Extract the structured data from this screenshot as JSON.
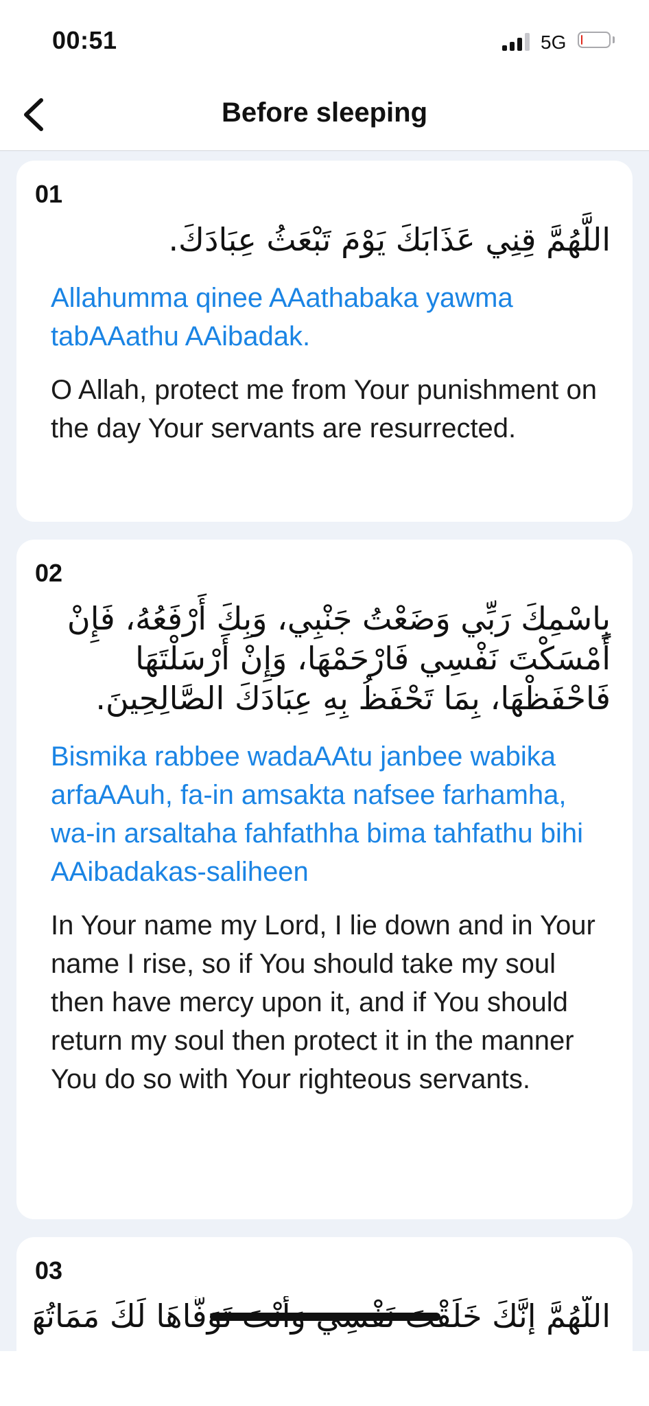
{
  "status_bar": {
    "time": "00:51",
    "network": "5G",
    "signal_bars_active": 3,
    "signal_bars_total": 4,
    "battery_level_percent": 5,
    "battery_color": "#e0281b"
  },
  "nav": {
    "back_icon": "chevron-left-icon",
    "title": "Before sleeping"
  },
  "colors": {
    "accent": "#1a84e4",
    "background": "#eef2f8",
    "card": "#ffffff"
  },
  "duas": [
    {
      "number": "01",
      "arabic": "اللَّهُمَّ قِنِي عَذَابَكَ يَوْمَ تَبْعَثُ عِبَادَكَ.",
      "transliteration": "Allahumma qinee AAathabaka yawma tabAAathu AAibadak.",
      "translation": "O Allah, protect me from Your punishment on the day Your servants are resurrected."
    },
    {
      "number": "02",
      "arabic": "بِاسْمِكَ رَبِّي وَضَعْتُ جَنْبِي، وَبِكَ أَرْفَعُهُ، فَإِنْ أَمْسَكْتَ نَفْسِي فَارْحَمْهَا، وَإِنْ أَرْسَلْتَهَا فَاحْفَظْهَا، بِمَا تَحْفَظُ بِهِ عِبَادَكَ الصَّالِحِينَ.",
      "transliteration": "Bismika rabbee wadaAAtu janbee wabika arfaAAuh, fa-in amsakta nafsee farhamha, wa-in arsaltaha fahfathha bima tahfathu bihi AAibadakas-saliheen",
      "translation": "In Your name my Lord, I lie down and in Your name I rise, so if You should take my soul then have mercy upon it, and if You should return my soul then protect it in the manner You do so with Your righteous servants."
    },
    {
      "number": "03",
      "arabic": "اللَّهُمَّ إِنَّكَ خَلَقْتَ نَفْسِي وَأَنْتَ تَوَفَّاهَا لَكَ مَمَاتُهَا"
    }
  ]
}
